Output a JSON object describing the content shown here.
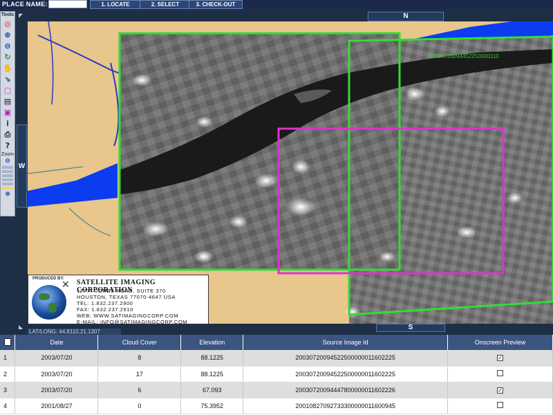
{
  "toolbar": {
    "place_label": "PLACE NAME:",
    "place_value": "",
    "steps": [
      "1. LOCATE",
      "2. SELECT",
      "3. CHECK-OUT"
    ]
  },
  "tools": {
    "title": "Tools",
    "zoom_label": "Zoom",
    "icons": [
      "target-icon",
      "zoom-in-icon",
      "zoom-out-icon",
      "pan-icon",
      "hand-icon",
      "select-icon",
      "select-box-icon",
      "layers-icon",
      "layer-select-icon",
      "info-icon",
      "print-icon",
      "help-icon",
      "search-icon"
    ]
  },
  "navigation": {
    "north": "N",
    "south": "S",
    "west": "W"
  },
  "map": {
    "scene_label": "20030720094452250000110"
  },
  "logo": {
    "produced_by": "PRODUCED BY:",
    "company": "SATELLITE IMAGING CORPORATION",
    "address1": "12777 JONES ROAD, SUITE 370",
    "address2": "HOUSTON, TEXAS 77070-4647 USA",
    "tel": "TEL: 1.832.237.2900",
    "fax": "FAX: 1.832.237.2910",
    "web": "WEB: WWW.SATIMAGINGCORP.COM",
    "email": "E-MAIL: INFO@SATIMAGINGCORP.COM"
  },
  "status": {
    "latlong": "LAT/LONG: 44.8110,21.1307"
  },
  "table": {
    "headers": [
      "Date",
      "Cloud Cover",
      "Elevation",
      "Source Image Id",
      "Onscreen Preview"
    ],
    "rows": [
      {
        "index": "1",
        "date": "2003/07/20",
        "cloud": "8",
        "elevation": "88.1225",
        "source": "20030720094522500000011602225",
        "preview": true
      },
      {
        "index": "2",
        "date": "2003/07/20",
        "cloud": "17",
        "elevation": "88.1225",
        "source": "20030720094522500000011602225",
        "preview": false
      },
      {
        "index": "3",
        "date": "2003/07/20",
        "cloud": "6",
        "elevation": "67.093",
        "source": "20030720094447800000011602226",
        "preview": true
      },
      {
        "index": "4",
        "date": "2001/08/27",
        "cloud": "0",
        "elevation": "75.3952",
        "source": "20010827092733300000011600945",
        "preview": false
      }
    ]
  },
  "colors": {
    "frame": "#1e2f45",
    "header": "#3a5580",
    "footprint_green": "#33dd33",
    "footprint_magenta": "#dd33cc",
    "river": "#0b3cf0",
    "land": "#e8c68c"
  }
}
